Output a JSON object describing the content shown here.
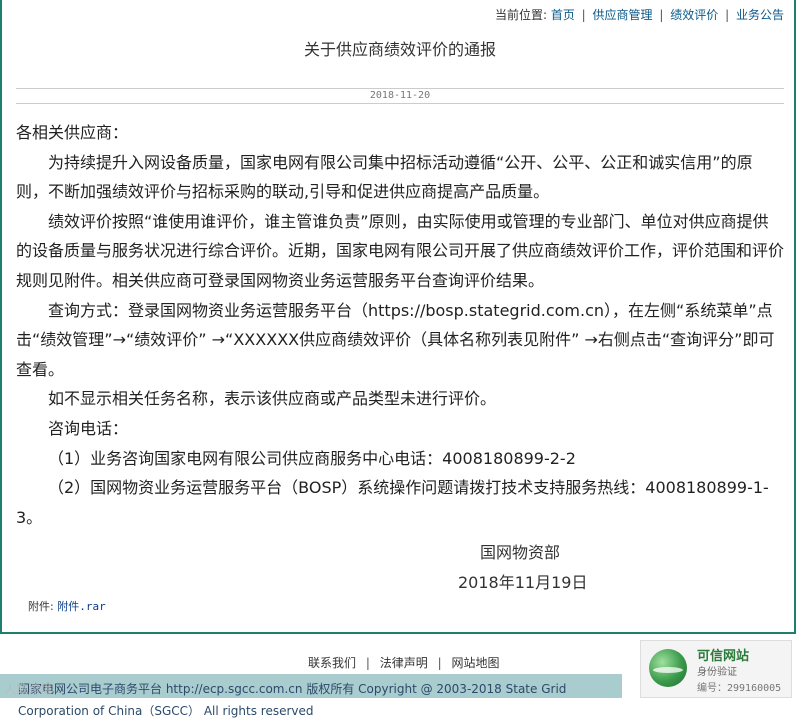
{
  "breadcrumb": {
    "prefix": "当前位置:",
    "items": [
      "首页",
      "供应商管理",
      "绩效评价",
      "业务公告"
    ],
    "separator": "|"
  },
  "article": {
    "title": "关于供应商绩效评价的通报",
    "date": "2018-11-20",
    "salutation": "各相关供应商：",
    "paragraphs": [
      "为持续提升入网设备质量，国家电网有限公司集中招标活动遵循“公开、公平、公正和诚实信用”的原则，不断加强绩效评价与招标采购的联动,引导和促进供应商提高产品质量。",
      "绩效评价按照“谁使用谁评价，谁主管谁负责”原则，由实际使用或管理的专业部门、单位对供应商提供的设备质量与服务状况进行综合评价。近期，国家电网有限公司开展了供应商绩效评价工作，评价范围和评价规则见附件。相关供应商可登录国网物资业务运营服务平台查询评价结果。",
      "查询方式：登录国网物资业务运营服务平台（https://bosp.stategrid.com.cn），在左侧“系统菜单”点击“绩效管理”→“绩效评价” →“XXXXXX供应商绩效评价（具体名称列表见附件” →右侧点击“查询评分”即可查看。",
      "如不显示相关任务名称，表示该供应商或产品类型未进行评价。",
      "咨询电话：",
      "（1）业务咨询国家电网有限公司供应商服务中心电话：4008180899-2-2",
      "（2）国网物资业务运营服务平台（BOSP）系统操作问题请拨打技术支持服务热线：4008180899-1-3。"
    ],
    "signer": "国网物资部",
    "sign_date": "2018年11月19日",
    "attachment_label": "附件:",
    "attachment_link": "附件.rar"
  },
  "footer": {
    "links": [
      "联系我们",
      "法律声明",
      "网站地图"
    ],
    "copyright": "国家电网公司电子商务平台 http://ecp.sgcc.com.cn 版权所有 Copyright @ 2003-2018 State Grid Corporation of China（SGCC） All rights reserved",
    "watermark": "人数跨境"
  },
  "trust_badge": {
    "title": "可信网站",
    "subtitle": "身份验证",
    "code": "编号：299160005"
  },
  "colors": {
    "border": "#1f7f6e",
    "link": "#0b5a8a",
    "copy_band": "#a9cccf"
  }
}
